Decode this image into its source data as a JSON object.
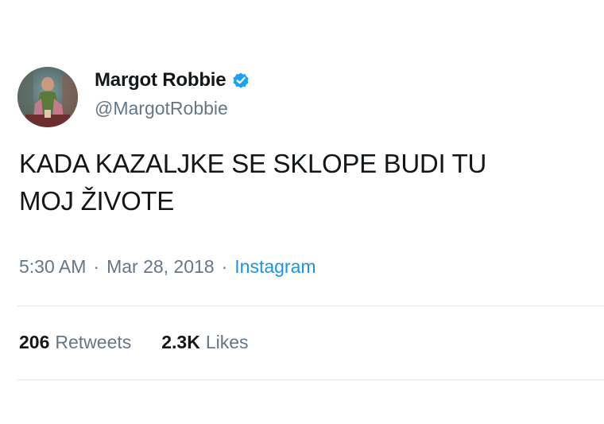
{
  "user": {
    "display_name": "Margot Robbie",
    "handle": "@MargotRobbie",
    "verified": true,
    "verified_color": "#1da1f2"
  },
  "tweet": {
    "text": "KADA KAZALJKE SE SKLOPE BUDI TU\nMOJ ŽIVOTE",
    "time": "5:30 AM",
    "separator": "·",
    "date": "Mar 28, 2018",
    "source": "Instagram"
  },
  "stats": {
    "retweets_count": "206",
    "retweets_label": "Retweets",
    "likes_count": "2.3K",
    "likes_label": "Likes"
  },
  "colors": {
    "text_primary": "#14171a",
    "text_secondary": "#657786",
    "link": "#1b95e0",
    "divider": "#e1e8ed"
  }
}
